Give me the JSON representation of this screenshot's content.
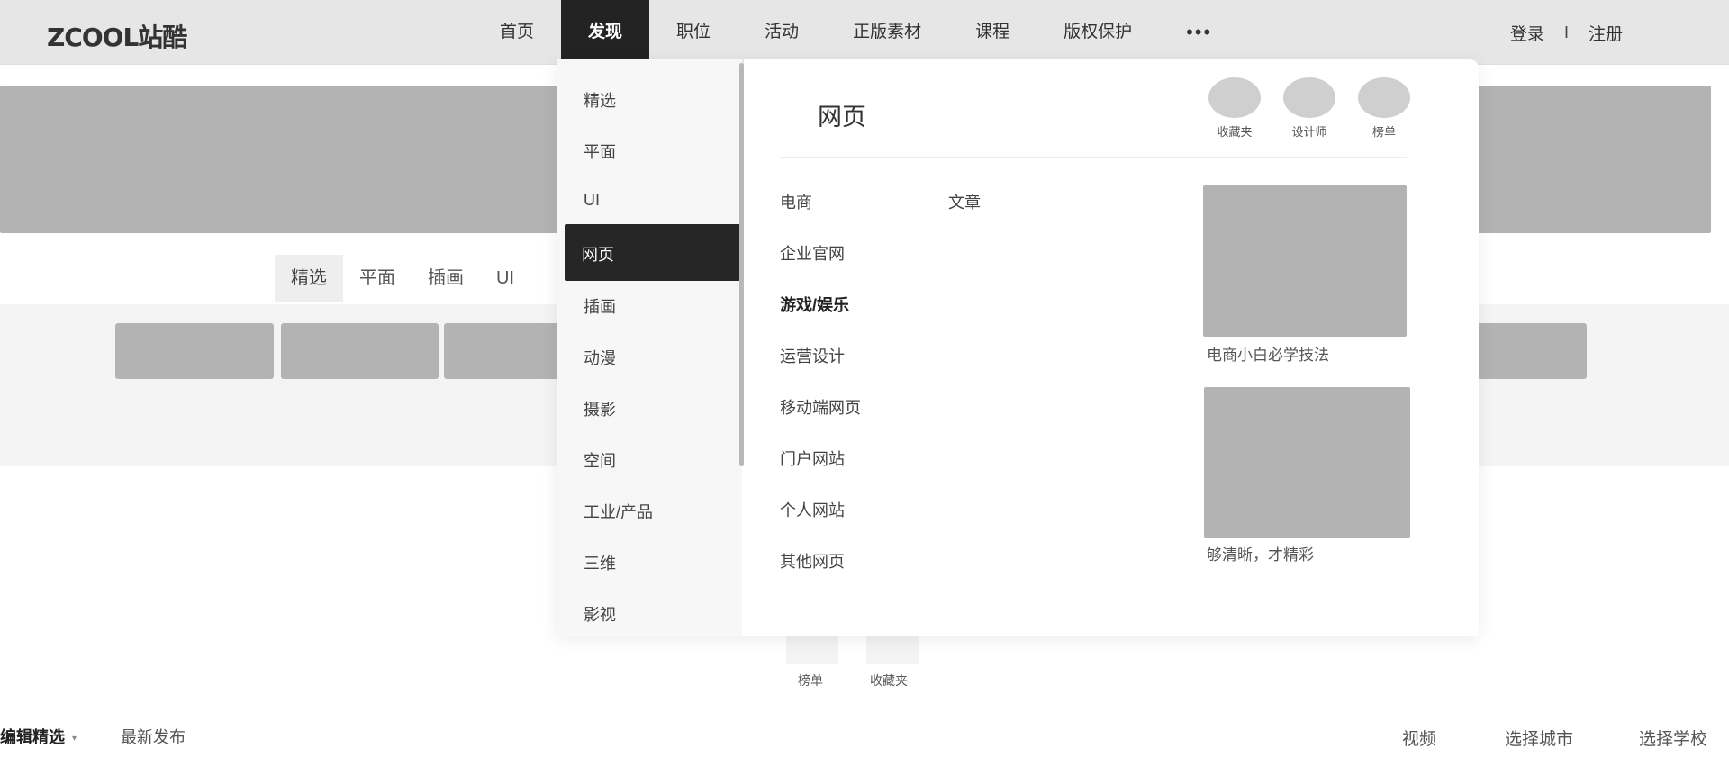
{
  "header": {
    "logo": "ZCOOL站酷",
    "nav": [
      "首页",
      "发现",
      "职位",
      "活动",
      "正版素材",
      "课程",
      "版权保护"
    ],
    "more": "•••",
    "login": "登录",
    "sep": "I",
    "register": "注册"
  },
  "subtabs": [
    "精选",
    "平面",
    "插画",
    "UI"
  ],
  "mini": {
    "rank": "榜单",
    "collect": "收藏夹"
  },
  "filters": {
    "editor": "编辑精选",
    "latest": "最新发布",
    "video": "视频",
    "city": "选择城市",
    "school": "选择学校"
  },
  "dropdown": {
    "left_items": [
      "精选",
      "平面",
      "UI",
      "网页",
      "插画",
      "动漫",
      "摄影",
      "空间",
      "工业/产品",
      "三维",
      "影视"
    ],
    "active_left": "网页",
    "title": "网页",
    "quick": [
      "收藏夹",
      "设计师",
      "榜单"
    ],
    "links_col1": [
      "电商",
      "企业官网",
      "游戏/娱乐",
      "运营设计",
      "移动端网页",
      "门户网站",
      "个人网站",
      "其他网页"
    ],
    "links_col2": [
      "文章"
    ],
    "promos": [
      {
        "caption": "电商小白必学技法"
      },
      {
        "caption": "够清晰，才精彩"
      }
    ]
  },
  "colors": {
    "header_bg": "#e6e6e6",
    "active_bg": "#232323",
    "placeholder": "#b3b3b3"
  }
}
